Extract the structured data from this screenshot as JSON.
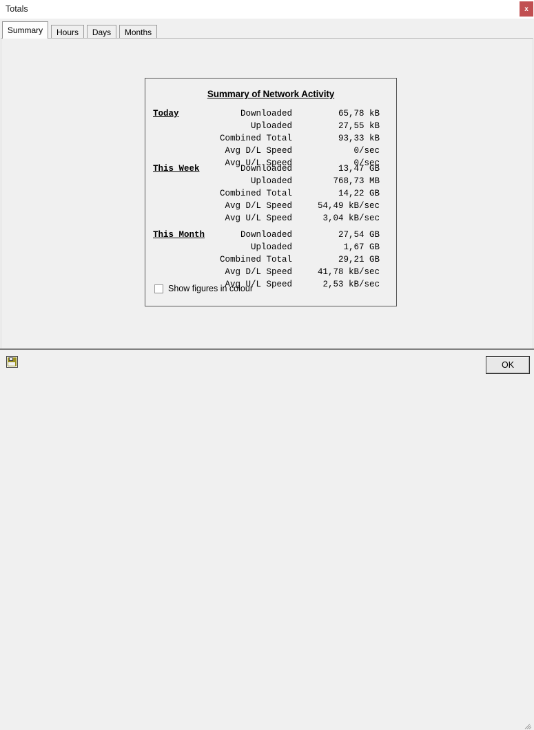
{
  "window": {
    "title": "Totals",
    "close_label": "x",
    "close_icon": "close-icon"
  },
  "tabs": [
    {
      "label": "Summary",
      "selected": true
    },
    {
      "label": "Hours",
      "selected": false
    },
    {
      "label": "Days",
      "selected": false
    },
    {
      "label": "Months",
      "selected": false
    }
  ],
  "summary": {
    "title": "Summary of Network Activity",
    "sections": [
      {
        "heading": "Today",
        "rows": [
          {
            "label": "Downloaded",
            "value": "65,78 kB"
          },
          {
            "label": "Uploaded",
            "value": "27,55 kB"
          },
          {
            "label": "Combined Total",
            "value": "93,33 kB"
          },
          {
            "label": "Avg D/L Speed",
            "value": "0/sec"
          },
          {
            "label": "Avg U/L Speed",
            "value": "0/sec"
          }
        ]
      },
      {
        "heading": "This Week",
        "rows": [
          {
            "label": "Downloaded",
            "value": "13,47 GB"
          },
          {
            "label": "Uploaded",
            "value": "768,73 MB"
          },
          {
            "label": "Combined Total",
            "value": "14,22 GB"
          },
          {
            "label": "Avg D/L Speed",
            "value": "54,49 kB/sec"
          },
          {
            "label": "Avg U/L Speed",
            "value": "3,04 kB/sec"
          }
        ]
      },
      {
        "heading": "This Month",
        "rows": [
          {
            "label": "Downloaded",
            "value": "27,54 GB"
          },
          {
            "label": "Uploaded",
            "value": "1,67 GB"
          },
          {
            "label": "Combined Total",
            "value": "29,21 GB"
          },
          {
            "label": "Avg D/L Speed",
            "value": "41,78 kB/sec"
          },
          {
            "label": "Avg U/L Speed",
            "value": "2,53 kB/sec"
          }
        ]
      }
    ],
    "checkbox": {
      "label": "Show figures in colour",
      "checked": false
    }
  },
  "bottom_bar": {
    "save_icon": "floppy-disk-save-icon",
    "ok_label": "OK"
  },
  "colors": {
    "close_button": "#c14f51",
    "window_background": "#f0f0f0",
    "panel_border": "#555555",
    "floppy_body": "#9a9020"
  }
}
